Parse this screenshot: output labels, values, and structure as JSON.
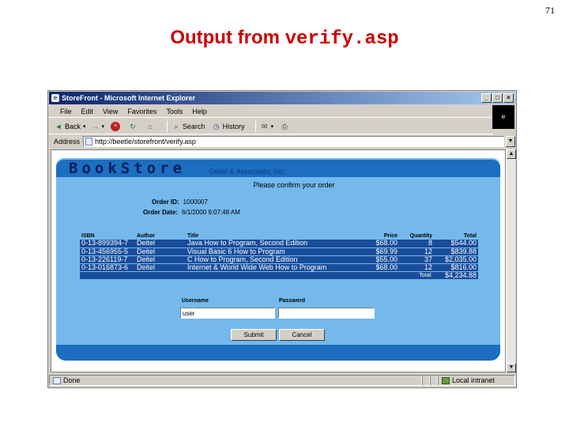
{
  "slide": {
    "number": "71",
    "title_text": "Output from ",
    "title_code": "verify.asp"
  },
  "browser": {
    "window_title": "StoreFront - Microsoft Internet Explorer",
    "menu": [
      "File",
      "Edit",
      "View",
      "Favorites",
      "Tools",
      "Help"
    ],
    "toolbar": {
      "back_label": "Back",
      "forward_arrow": "→",
      "search_label": "Search",
      "history_label": "History"
    },
    "address_label": "Address",
    "address_value": "http://beetle/storefront/verify.asp",
    "status_text": "Done",
    "zone_text": "Local intranet"
  },
  "page": {
    "logo": "BookStore",
    "logo_sub": "Deitel & Associates, Inc.",
    "confirm_text": "Please confirm your order",
    "order_id_label": "Order ID:",
    "order_id_value": "1000007",
    "order_date_label": "Order Date:",
    "order_date_value": "6/1/2000 9:07:48 AM",
    "table": {
      "headers": [
        "ISBN",
        "Author",
        "Title",
        "Price",
        "Quantity",
        "Total"
      ],
      "rows": [
        [
          "0-13-899394-7",
          "Deitel",
          "Java How to Program, Second Edition",
          "$68.00",
          "8",
          "$544.00"
        ],
        [
          "0-13-456955-5",
          "Deitel",
          "Visual Basic 6 How to Program",
          "$69.99",
          "12",
          "$839.88"
        ],
        [
          "0-13-226119-7",
          "Deitel",
          "C How to Program, Second Edition",
          "$55.00",
          "37",
          "$2,035.00"
        ],
        [
          "0-13-016873-6",
          "Deitel",
          "Internet & World Wide Web How to Program",
          "$68.00",
          "12",
          "$816.00"
        ]
      ],
      "total_label": "Total:",
      "total_value": "$4,234.88"
    },
    "form": {
      "username_label": "Username",
      "username_value": "user",
      "password_label": "Password",
      "password_value": "",
      "submit_label": "Submit",
      "cancel_label": "Cancel"
    }
  },
  "colors": {
    "title_red": "#cc0000",
    "page_blue": "#74b8ec",
    "row_blue": "#184c9a",
    "titlebar_start": "#0a246a"
  },
  "icons": [
    "ie-app-icon",
    "back-arrow-icon",
    "stop-icon",
    "refresh-icon",
    "home-icon",
    "search-icon",
    "history-icon",
    "mail-icon",
    "print-icon",
    "page-icon",
    "local-intranet-icon"
  ]
}
